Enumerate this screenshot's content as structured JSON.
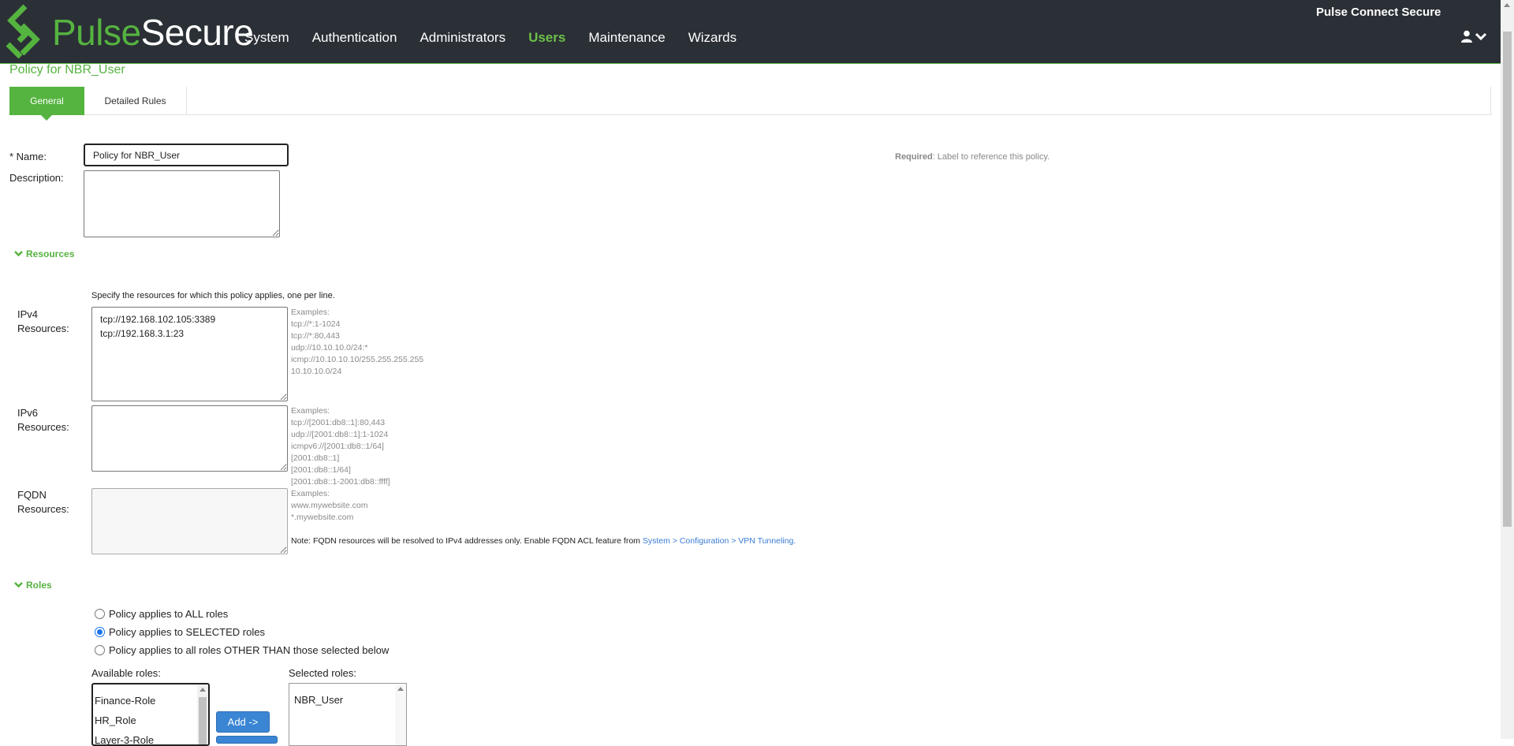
{
  "header": {
    "logo": {
      "word1": "Pulse",
      "word2": "Secure"
    },
    "nav": [
      {
        "label": "System",
        "active": false
      },
      {
        "label": "Authentication",
        "active": false
      },
      {
        "label": "Administrators",
        "active": false
      },
      {
        "label": "Users",
        "active": true
      },
      {
        "label": "Maintenance",
        "active": false
      },
      {
        "label": "Wizards",
        "active": false
      }
    ],
    "product_name": "Pulse Connect Secure",
    "user_icon": "user-icon",
    "colors": {
      "brand_green": "#55b340",
      "header_bg": "#2b2f36"
    }
  },
  "page": {
    "title": "Policy for NBR_User",
    "tabs": [
      {
        "label": "General",
        "active": true
      },
      {
        "label": "Detailed Rules",
        "active": false
      }
    ]
  },
  "form": {
    "name_label": "* Name:",
    "name_value": "Policy for NBR_User",
    "name_required_bold": "Required",
    "name_required_text": ": Label to reference this policy.",
    "description_label": "Description:",
    "description_value": ""
  },
  "resources": {
    "section_label": "Resources",
    "hint": "Specify the resources for which this policy applies, one per line.",
    "ipv4": {
      "label_line1": "IPv4",
      "label_line2": "Resources:",
      "value": "tcp://192.168.102.105:3389\ntcp://192.168.3.1:23",
      "examples": [
        "Examples:",
        "tcp://*:1-1024",
        "tcp://*:80,443",
        "udp://10.10.10.0/24:*",
        "icmp://10.10.10.10/255.255.255.255",
        "10.10.10.0/24"
      ]
    },
    "ipv6": {
      "label_line1": "IPv6",
      "label_line2": "Resources:",
      "value": "",
      "examples": [
        "Examples:",
        "tcp://[2001:db8::1]:80,443",
        "udp://[2001:db8::1]:1-1024",
        "icmpv6://[2001:db8::1/64]",
        "[2001:db8::1]",
        "[2001:db8::1/64]",
        "[2001:db8::1-2001:db8::ffff]"
      ]
    },
    "fqdn": {
      "label_line1": "FQDN",
      "label_line2": "Resources:",
      "value": "",
      "examples": [
        "Examples:",
        "www.mywebsite.com",
        "*.mywebsite.com"
      ],
      "note_text": "Note: FQDN resources will be resolved to IPv4 addresses only. Enable FQDN ACL feature from ",
      "note_link": "System > Configuration > VPN Tunneling."
    }
  },
  "roles": {
    "section_label": "Roles",
    "options": [
      {
        "label": "Policy applies to ALL roles",
        "checked": false
      },
      {
        "label": "Policy applies to SELECTED roles",
        "checked": true
      },
      {
        "label": "Policy applies to all roles OTHER THAN those selected below",
        "checked": false
      }
    ],
    "available_label": "Available roles:",
    "available": [
      "Finance-Role",
      "HR_Role",
      "Layer-3-Role"
    ],
    "selected_label": "Selected roles:",
    "selected": [
      "NBR_User"
    ],
    "add_button": "Add ->"
  }
}
